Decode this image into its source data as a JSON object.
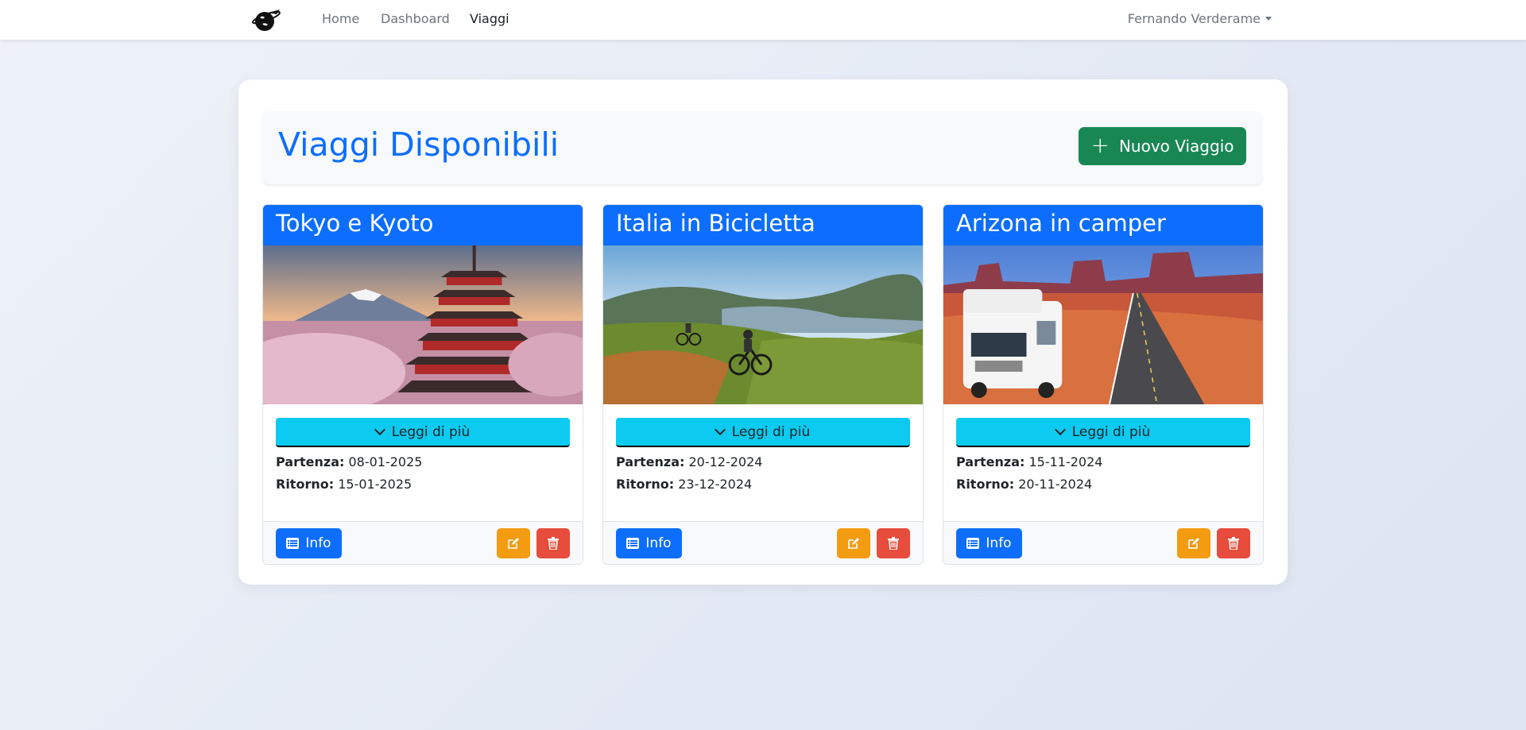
{
  "nav": {
    "links": [
      "Home",
      "Dashboard",
      "Viaggi"
    ],
    "active": "Viaggi",
    "user": "Fernando Verderame"
  },
  "page": {
    "title": "Viaggi Disponibili",
    "new_button": "Nuovo Viaggio"
  },
  "labels": {
    "read_more": "Leggi di più",
    "departure": "Partenza:",
    "return": "Ritorno:",
    "info": "Info"
  },
  "trips": [
    {
      "title": "Tokyo e Kyoto",
      "departure": "08-01-2025",
      "return": "15-01-2025",
      "image": "mount-fuji-pagoda-photo"
    },
    {
      "title": "Italia in Bicicletta",
      "departure": "20-12-2024",
      "return": "23-12-2024",
      "image": "cyclists-countryside-photo"
    },
    {
      "title": "Arizona in camper",
      "departure": "15-11-2024",
      "return": "20-11-2024",
      "image": "rv-desert-road-photo"
    }
  ],
  "colors": {
    "primary": "#0d6efd",
    "success": "#198754",
    "info": "#0dcaf0",
    "warning": "#f39c12",
    "danger": "#e74c3c"
  }
}
